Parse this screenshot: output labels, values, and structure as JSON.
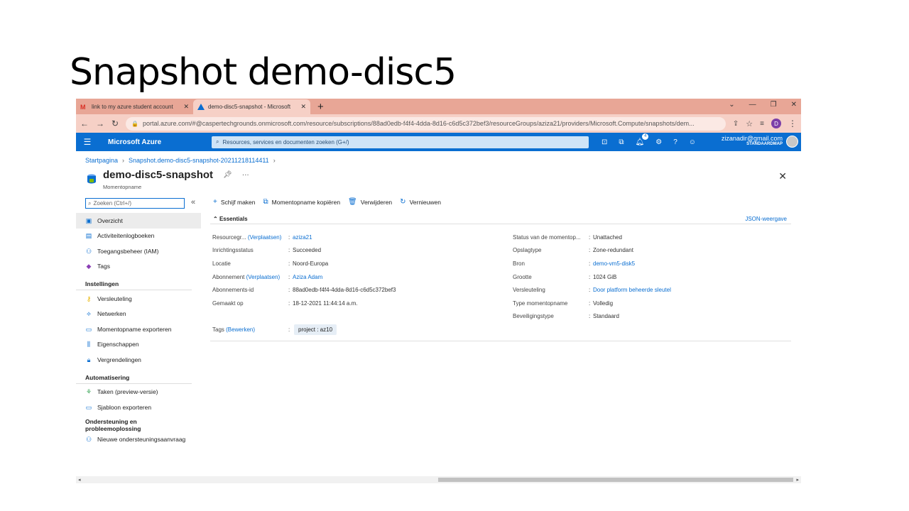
{
  "slide": {
    "title": "Snapshot demo-disc5"
  },
  "browser": {
    "tabs": [
      {
        "title": "link to my azure student account",
        "icon": "gmail-icon"
      },
      {
        "title": "demo-disc5-snapshot - Microsoft",
        "icon": "azure-icon"
      }
    ],
    "new_tab": "+",
    "url": "portal.azure.com/#@caspertechgrounds.onmicrosoft.com/resource/subscriptions/88ad0edb-f4f4-4dda-8d16-c6d5c372bef3/resourceGroups/aziza21/providers/Microsoft.Compute/snapshots/dem...",
    "profile_letter": "D"
  },
  "azure": {
    "brand": "Microsoft Azure",
    "search_placeholder": "Resources, services en documenten zoeken (G+/)",
    "notifications_count": "4",
    "user_email": "zizanadir@gmail.com",
    "user_dir": "STANDAARDMAP"
  },
  "breadcrumb": [
    "Startpagina",
    "Snapshot.demo-disc5-snapshot-20211218114411"
  ],
  "resource": {
    "title": "demo-disc5-snapshot",
    "subtitle": "Momentopname"
  },
  "nav": {
    "search_placeholder": "Zoeken (Ctrl+/)",
    "top_items": [
      "Overzicht",
      "Activiteitenlogboeken",
      "Toegangsbeheer (IAM)",
      "Tags"
    ],
    "sections": [
      {
        "title": "Instellingen",
        "items": [
          "Versleuteling",
          "Netwerken",
          "Momentopname exporteren",
          "Eigenschappen",
          "Vergrendelingen"
        ]
      },
      {
        "title": "Automatisering",
        "items": [
          "Taken (preview-versie)",
          "Sjabloon exporteren"
        ]
      },
      {
        "title": "Ondersteuning en probleemoplossing",
        "items": [
          "Nieuwe ondersteuningsaanvraag"
        ]
      }
    ]
  },
  "commands": [
    "Schijf maken",
    "Momentopname kopiëren",
    "Verwijderen",
    "Vernieuwen"
  ],
  "essentials": {
    "header": "Essentials",
    "json_view": "JSON-weergave",
    "left": [
      {
        "key": "Resourcegr...",
        "key_link": "(Verplaatsen)",
        "value": "aziza21",
        "value_link": true
      },
      {
        "key": "Inrichtingsstatus",
        "key_link": "",
        "value": "Succeeded",
        "value_link": false
      },
      {
        "key": "Locatie",
        "key_link": "",
        "value": "Noord-Europa",
        "value_link": false
      },
      {
        "key": "Abonnement",
        "key_link": "(Verplaatsen)",
        "value": "Aziza Adam",
        "value_link": true
      },
      {
        "key": "Abonnements-id",
        "key_link": "",
        "value": "88ad0edb-f4f4-4dda-8d16-c6d5c372bef3",
        "value_link": false
      },
      {
        "key": "Gemaakt op",
        "key_link": "",
        "value": "18-12-2021 11:44:14 a.m.",
        "value_link": false
      }
    ],
    "right": [
      {
        "key": "Status van de momentop...",
        "value": "Unattached",
        "value_link": false
      },
      {
        "key": "Opslagtype",
        "value": "Zone-redundant",
        "value_link": false
      },
      {
        "key": "Bron",
        "value": "demo-vm5-disk5",
        "value_link": true
      },
      {
        "key": "Grootte",
        "value": "1024 GiB",
        "value_link": false
      },
      {
        "key": "Versleuteling",
        "value": "Door platform beheerde sleutel",
        "value_link": true
      },
      {
        "key": "Type momentopname",
        "value": "Volledig",
        "value_link": false
      },
      {
        "key": "Beveiligingstype",
        "value": "Standaard",
        "value_link": false
      }
    ],
    "tags_label": "Tags",
    "tags_edit": "(Bewerken)",
    "tag_value": "project : az10"
  }
}
